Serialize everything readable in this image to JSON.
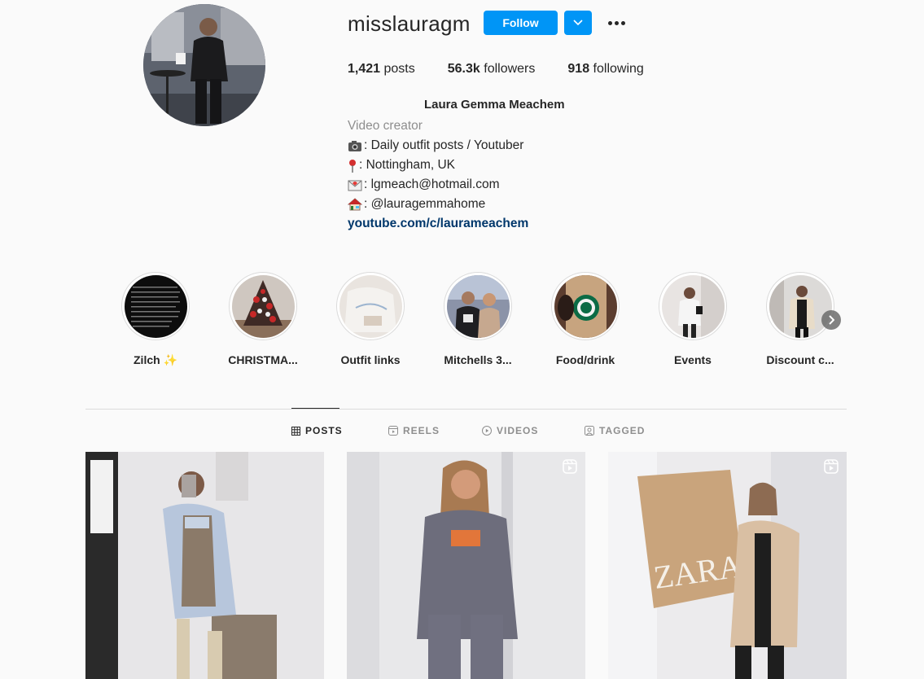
{
  "profile": {
    "username": "misslauragm",
    "follow_label": "Follow",
    "stats": {
      "posts": "1,421",
      "posts_label": "posts",
      "followers": "56.3k",
      "followers_label": "followers",
      "following": "918",
      "following_label": "following"
    },
    "full_name": "Laura Gemma Meachem",
    "category": "Video creator",
    "bio_lines": [
      {
        "icon": "camera-emoji-icon",
        "text": ": Daily outfit posts / Youtuber"
      },
      {
        "icon": "pushpin-emoji-icon",
        "text": ": Nottingham, UK"
      },
      {
        "icon": "envelope-emoji-icon",
        "text": ": lgmeach@hotmail.com"
      },
      {
        "icon": "house-emoji-icon",
        "text": ": @lauragemmahome"
      }
    ],
    "website": "youtube.com/c/laurameachem"
  },
  "highlights": [
    {
      "label": "Zilch ✨",
      "thumb": "text-screenshot"
    },
    {
      "label": "CHRISTMA...",
      "thumb": "christmas-tree"
    },
    {
      "label": "Outfit links",
      "thumb": "clothing"
    },
    {
      "label": "Mitchells 3...",
      "thumb": "people"
    },
    {
      "label": "Food/drink",
      "thumb": "starbucks-cup"
    },
    {
      "label": "Events",
      "thumb": "mirror-selfie"
    },
    {
      "label": "Discount c...",
      "thumb": "mirror-selfie"
    }
  ],
  "tabs": [
    {
      "label": "POSTS",
      "icon": "grid-icon",
      "active": true
    },
    {
      "label": "REELS",
      "icon": "reels-icon",
      "active": false
    },
    {
      "label": "VIDEOS",
      "icon": "play-circle-icon",
      "active": false
    },
    {
      "label": "TAGGED",
      "icon": "tagged-icon",
      "active": false
    }
  ],
  "posts": [
    {
      "type": "photo",
      "reel": false
    },
    {
      "type": "reel",
      "reel": true
    },
    {
      "type": "reel",
      "reel": true
    }
  ],
  "colors": {
    "accent": "#0095f6",
    "link": "#00376b",
    "muted": "#8e8e8e",
    "border": "#dbdbdb"
  }
}
